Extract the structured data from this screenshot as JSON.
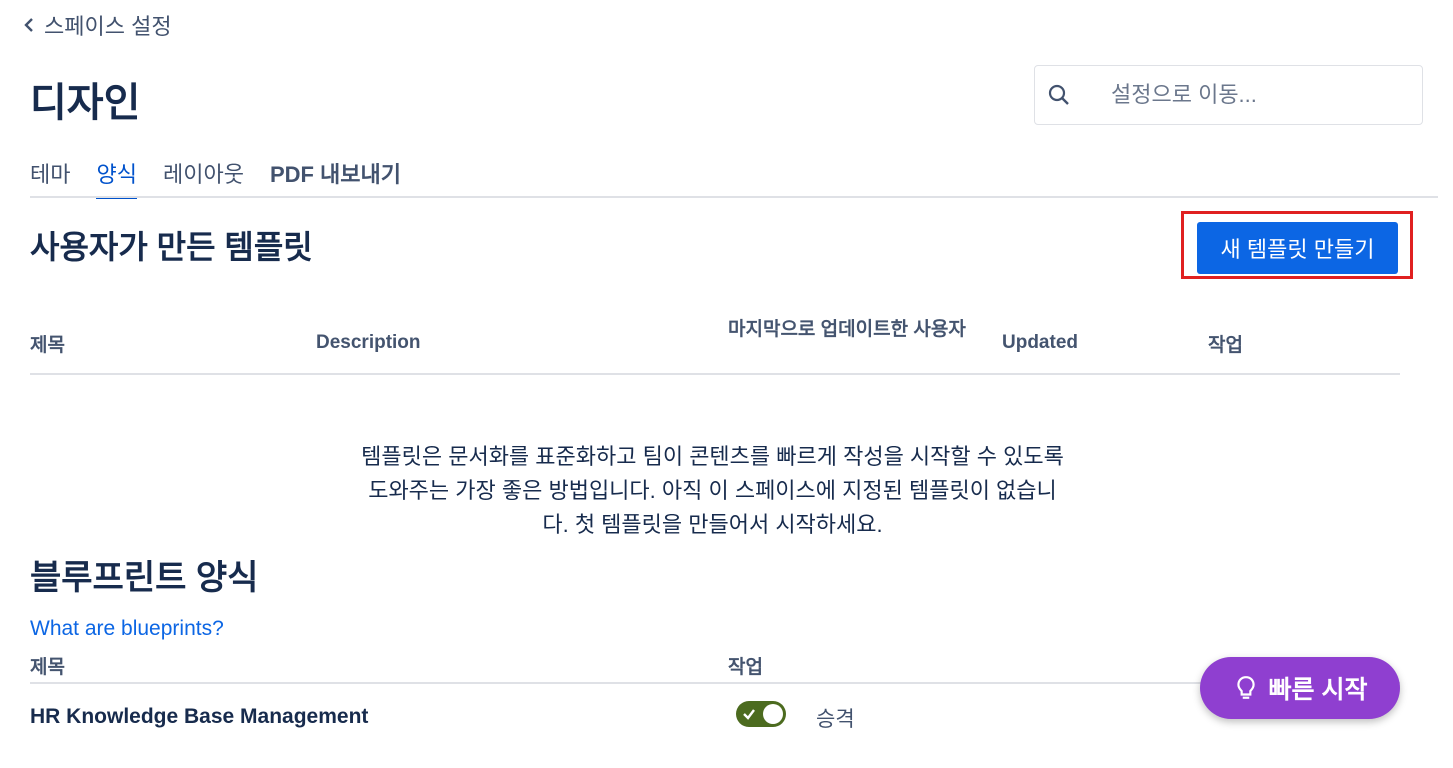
{
  "back": {
    "label": "스페이스 설정",
    "icon": "chevron-left-icon"
  },
  "page_title": "디자인",
  "search": {
    "placeholder": "설정으로 이동...",
    "icon": "search-icon"
  },
  "tabs": [
    {
      "label": "테마",
      "active": false
    },
    {
      "label": "양식",
      "active": true
    },
    {
      "label": "레이아웃",
      "active": false
    },
    {
      "label": "PDF 내보내기",
      "active": false
    }
  ],
  "user_templates": {
    "title": "사용자가 만든 템플릿",
    "new_button": "새 템플릿 만들기",
    "columns": [
      "제목",
      "Description",
      "마지막으로 업데이트한 사용자",
      "Updated",
      "작업"
    ],
    "empty_message": "템플릿은 문서화를 표준화하고 팀이 콘텐츠를 빠르게 작성을 시작할 수 있도록 도와주는 가장 좋은 방법입니다. 아직 이 스페이스에 지정된 템플릿이 없습니다. 첫 템플릿을 만들어서 시작하세요."
  },
  "blueprints": {
    "title": "블루프린트 양식",
    "help_link": "What are blueprints?",
    "columns": [
      "제목",
      "작업"
    ],
    "rows": [
      {
        "title": "HR Knowledge Base Management",
        "enabled": true,
        "action_label": "승격"
      }
    ]
  },
  "quick_start": {
    "label": "빠른 시작",
    "icon": "lightbulb-icon"
  },
  "colors": {
    "primary": "#0c66e4",
    "highlight": "#e02020",
    "toggle_on": "#4c6b1f",
    "quick_start": "#8f3fd0"
  }
}
